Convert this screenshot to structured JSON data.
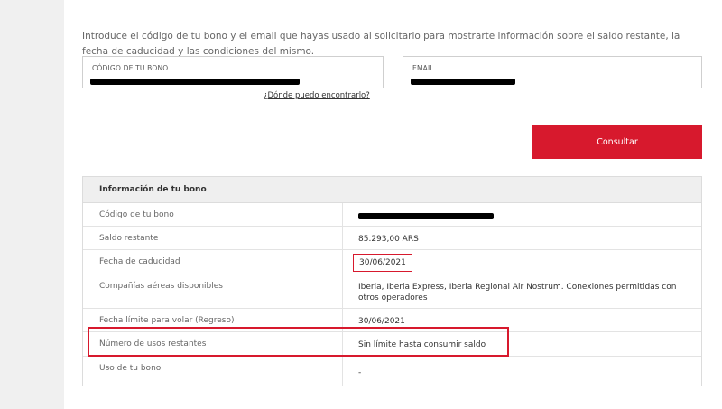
{
  "intro": "Introduce el código de tu bono y el email que hayas usado al solicitarlo para mostrarte información sobre el saldo restante, la fecha de caducidad y las condiciones del mismo.",
  "form": {
    "code_label": "CÓDIGO DE TU BONO",
    "email_label": "EMAIL",
    "help_link": "¿Dónde puedo encontrarlo?",
    "submit_label": "Consultar"
  },
  "info": {
    "title": "Información de tu bono",
    "rows": [
      {
        "label": "Código de tu bono",
        "value": ""
      },
      {
        "label": "Saldo restante",
        "value": "85.293,00 ARS"
      },
      {
        "label": "Fecha de caducidad",
        "value": "30/06/2021"
      },
      {
        "label": "Compañías aéreas disponibles",
        "value": "Iberia, Iberia Express, Iberia Regional Air Nostrum. Conexiones permitidas con otros operadores"
      },
      {
        "label": "Fecha límite para volar (Regreso)",
        "value": "30/06/2021"
      },
      {
        "label": "Número de usos restantes",
        "value": "Sin límite hasta consumir saldo"
      },
      {
        "label": "Uso de tu bono",
        "value": "-"
      }
    ]
  },
  "colors": {
    "accent": "#d7192d",
    "header_bg": "#efefef"
  }
}
